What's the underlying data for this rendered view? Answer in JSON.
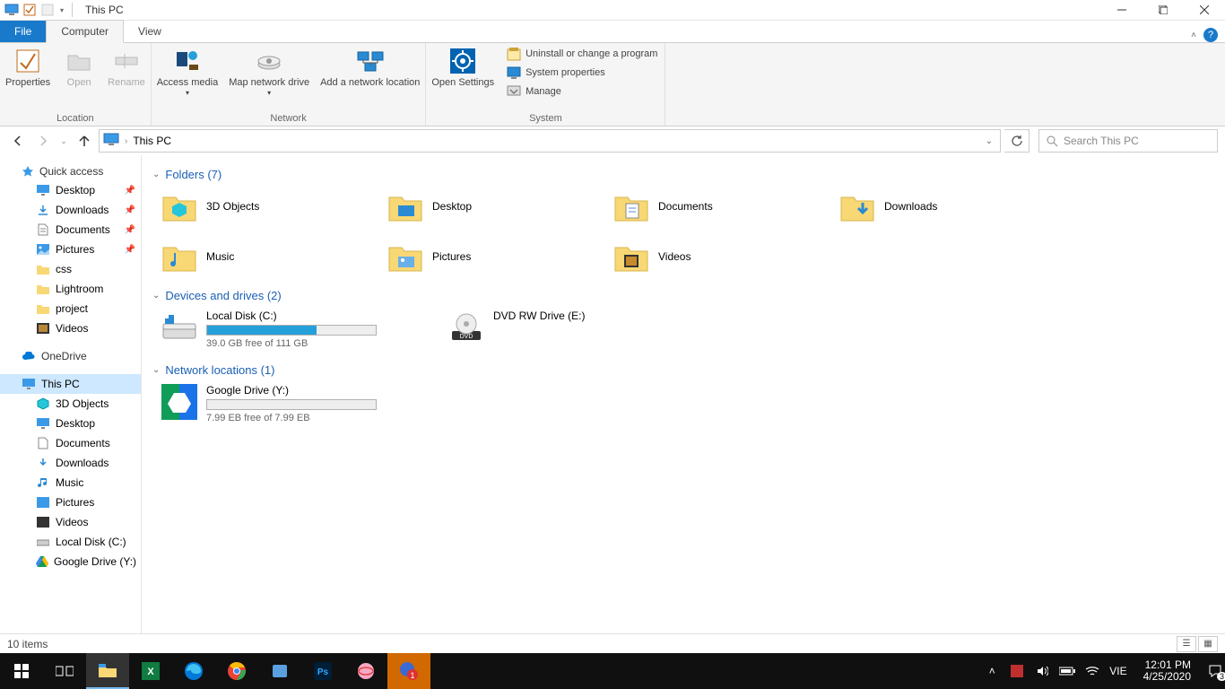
{
  "title": "This PC",
  "ribbon_tabs": {
    "file": "File",
    "computer": "Computer",
    "view": "View"
  },
  "ribbon": {
    "location": {
      "label": "Location",
      "properties": "Properties",
      "open": "Open",
      "rename": "Rename"
    },
    "network": {
      "label": "Network",
      "access_media": "Access media",
      "map_drive": "Map network drive",
      "add_location": "Add a network location"
    },
    "system": {
      "label": "System",
      "open_settings": "Open Settings",
      "uninstall": "Uninstall or change a program",
      "properties": "System properties",
      "manage": "Manage"
    }
  },
  "address": {
    "path": "This PC",
    "search_placeholder": "Search This PC"
  },
  "sidebar": {
    "quick_access": "Quick access",
    "desktop": "Desktop",
    "downloads": "Downloads",
    "documents": "Documents",
    "pictures": "Pictures",
    "css": "css",
    "lightroom": "Lightroom",
    "project": "project",
    "videos": "Videos",
    "onedrive": "OneDrive",
    "this_pc": "This PC",
    "objects3d": "3D Objects",
    "desktop2": "Desktop",
    "documents2": "Documents",
    "downloads2": "Downloads",
    "music": "Music",
    "pictures2": "Pictures",
    "videos2": "Videos",
    "local_disk": "Local Disk (C:)",
    "gdrive": "Google Drive (Y:)"
  },
  "content": {
    "folders_head": "Folders (7)",
    "folders": [
      {
        "name": "3D Objects"
      },
      {
        "name": "Desktop"
      },
      {
        "name": "Documents"
      },
      {
        "name": "Downloads"
      },
      {
        "name": "Music"
      },
      {
        "name": "Pictures"
      },
      {
        "name": "Videos"
      }
    ],
    "devices_head": "Devices and drives (2)",
    "local_disk": {
      "name": "Local Disk (C:)",
      "sub": "39.0 GB free of 111 GB",
      "fill_pct": 65
    },
    "dvd": {
      "name": "DVD RW Drive (E:)"
    },
    "network_head": "Network locations (1)",
    "gdrive": {
      "name": "Google Drive (Y:)",
      "sub": "7.99 EB free of 7.99 EB",
      "fill_pct": 0
    }
  },
  "statusbar": {
    "items": "10 items"
  },
  "taskbar": {
    "ime": "VIE",
    "time": "12:01 PM",
    "date": "4/25/2020",
    "badge": "3"
  }
}
